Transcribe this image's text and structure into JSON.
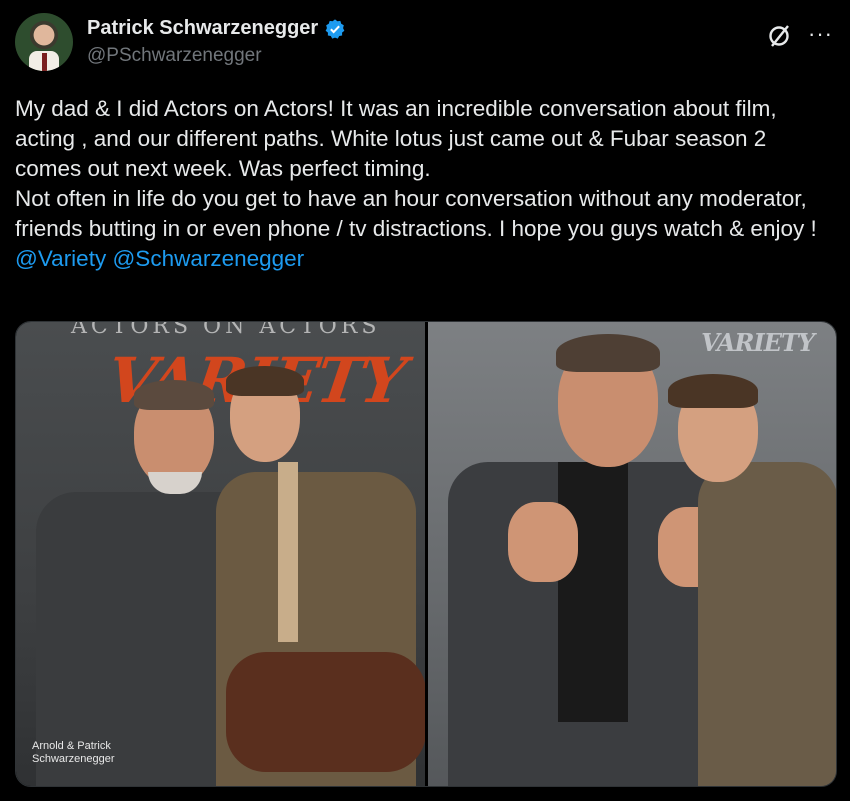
{
  "author": {
    "name": "Patrick Schwarzenegger",
    "handle": "@PSchwarzenegger",
    "verified": true
  },
  "icons": {
    "verified": "verified-badge-icon",
    "grok": "grok-icon",
    "more": "more-options-icon"
  },
  "colors": {
    "background": "#000000",
    "text": "#e7e9ea",
    "secondary": "#71767b",
    "accent": "#1d9bf0",
    "variety_red": "#d2461d"
  },
  "tweet": {
    "line1": "My dad & I did Actors on Actors! It was an incredible conversation about film, acting , and our different paths. White lotus just came out & Fubar season 2 comes out next week. Was perfect timing.",
    "line2": "Not often in life do you get to have an hour conversation without any moderator, friends butting in or even phone / tv distractions. I hope you guys watch & enjoy ! ",
    "mention1": "@Variety",
    "mention2": "@Schwarzenegger"
  },
  "media": {
    "left": {
      "masthead_top": "ACTORS ON ACTORS",
      "masthead": "VARIETY",
      "caption_line1": "Arnold & Patrick",
      "caption_line2": "Schwarzenegger"
    },
    "right": {
      "masthead": "VARIETY"
    }
  },
  "more_label": "···"
}
